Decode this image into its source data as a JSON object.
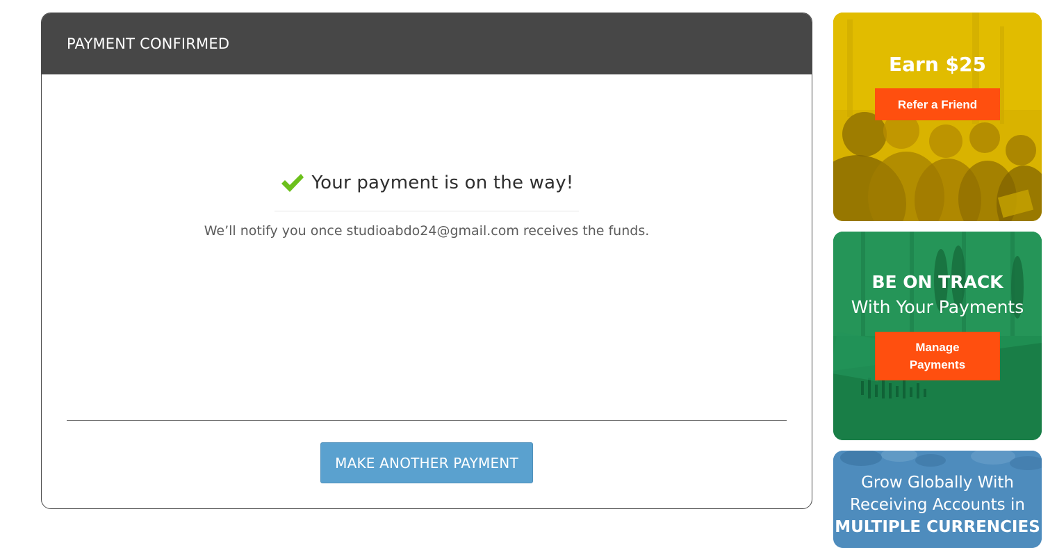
{
  "confirmation": {
    "header_title": "PAYMENT CONFIRMED",
    "heading": "Your payment is on the way!",
    "notify_message": "We’ll notify you once studioabdo24@gmail.com receives the funds.",
    "make_another_label": "MAKE ANOTHER PAYMENT",
    "check_icon": "checkmark-icon",
    "accent_color": "#5aa1cf",
    "check_color": "#6cc01c"
  },
  "promos": {
    "referral": {
      "title": "Earn $25",
      "cta_label": "Refer a Friend",
      "bg_color": "#d9b300"
    },
    "payments": {
      "title": "BE ON TRACK",
      "subtitle": "With Your Payments",
      "cta_line1": "Manage",
      "cta_line2": "Payments",
      "bg_color": "#1f8e52"
    },
    "currencies": {
      "line1": "Grow Globally With",
      "line2": "Receiving Accounts in",
      "line3": "MULTIPLE CURRENCIES",
      "bg_color": "#4e8cbd"
    },
    "cta_color": "#ff4f0f"
  }
}
